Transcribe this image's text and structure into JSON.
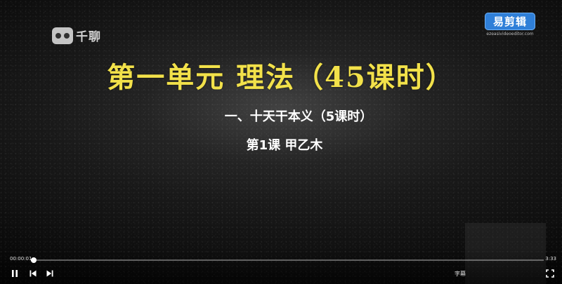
{
  "watermarks": {
    "left_text": "千聊",
    "right_badge": "易剪辑",
    "right_url": "ezeasivideoeditor.com"
  },
  "slide": {
    "title": "第一单元  理法（45课时）",
    "subtitle": "一、十天干本义（5课时）",
    "lesson": "第1课  甲乙木"
  },
  "player": {
    "current_time": "00:00:01",
    "total_time": "3:33",
    "progress": 0.005,
    "subtitles_label": "字幕",
    "icons": {
      "pause": "pause-icon",
      "prev": "skip-previous-icon",
      "next": "skip-next-icon",
      "fullscreen": "fullscreen-icon"
    }
  },
  "colors": {
    "title": "#f2e14a",
    "text": "#ffffff",
    "badge": "#2f7fd8"
  }
}
